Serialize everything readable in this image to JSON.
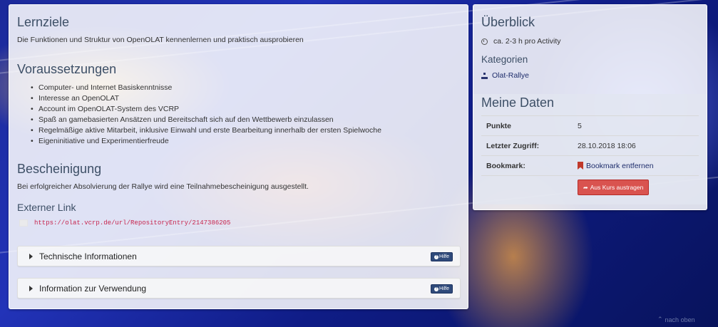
{
  "lernziele": {
    "title": "Lernziele",
    "text": "Die Funktionen und Struktur von OpenOLAT kennenlernen und praktisch ausprobieren"
  },
  "voraussetzungen": {
    "title": "Voraussetzungen",
    "items": [
      "Computer- und Internet Basiskenntnisse",
      "Interesse an OpenOLAT",
      "Account im OpenOLAT-System des VCRP",
      "Spaß an gamebasierten Ansätzen und Bereitschaft sich auf den Wettbewerb einzulassen",
      "Regelmäßige aktive Mitarbeit, inklusive Einwahl und erste Bearbeitung innerhalb der ersten Spielwoche",
      "Eigeninitiative und Experimentierfreude"
    ]
  },
  "bescheinigung": {
    "title": "Bescheinigung",
    "text": "Bei erfolgreicher Absolvierung der Rallye wird eine Teilnahmebescheinigung ausgestellt."
  },
  "externer_link": {
    "title": "Externer Link",
    "url": "https://olat.vcrp.de/url/RepositoryEntry/2147386205"
  },
  "collapsibles": [
    {
      "label": "Technische Informationen",
      "help": "Hilfe"
    },
    {
      "label": "Information zur Verwendung",
      "help": "Hilfe"
    }
  ],
  "ueberblick": {
    "title": "Überblick",
    "duration": "ca. 2-3 h pro Activity",
    "kategorien_title": "Kategorien",
    "category": "Olat-Rallye"
  },
  "meine_daten": {
    "title": "Meine Daten",
    "rows": [
      {
        "key": "Punkte",
        "value": "5"
      },
      {
        "key": "Letzter Zugriff:",
        "value": "28.10.2018 18:06"
      },
      {
        "key": "Bookmark:",
        "value": "Bookmark entfernen"
      }
    ],
    "leave_button": "Aus Kurs austragen"
  },
  "footer": {
    "back_to_top": "nach oben"
  }
}
